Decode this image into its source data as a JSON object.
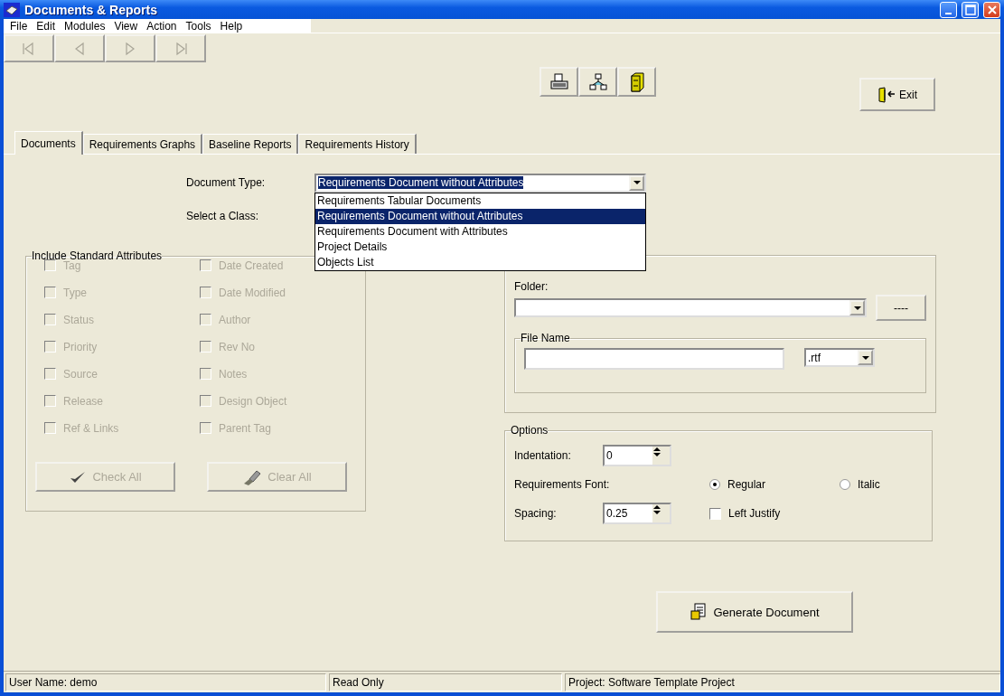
{
  "window": {
    "title": "Documents & Reports"
  },
  "menu": [
    "File",
    "Edit",
    "Modules",
    "View",
    "Action",
    "Tools",
    "Help"
  ],
  "nav_buttons": [
    {
      "kind": "first",
      "disabled": true
    },
    {
      "kind": "previous",
      "disabled": true
    },
    {
      "kind": "next",
      "disabled": true
    },
    {
      "kind": "last",
      "disabled": true
    }
  ],
  "tool_buttons": [
    {
      "kind": "print"
    },
    {
      "kind": "diagram"
    },
    {
      "kind": "cabinet"
    }
  ],
  "exit_button": {
    "label": "Exit"
  },
  "tabs": [
    {
      "label": "Documents",
      "selected": true
    },
    {
      "label": "Requirements Graphs",
      "selected": false
    },
    {
      "label": "Baseline Reports",
      "selected": false
    },
    {
      "label": "Requirements History",
      "selected": false
    }
  ],
  "document_type": {
    "label": "Document Type:",
    "value": "Requirements Document without Attributes",
    "expanded": true,
    "options": [
      {
        "label": "Requirements Tabular Documents",
        "selected": false
      },
      {
        "label": "Requirements Document without Attributes",
        "selected": true
      },
      {
        "label": "Requirements Document with Attributes",
        "selected": false
      },
      {
        "label": "Project Details",
        "selected": false
      },
      {
        "label": "Objects List",
        "selected": false
      }
    ]
  },
  "class_label": "Select a Class:",
  "attributes": {
    "title": "Include Standard Attributes",
    "items": [
      {
        "label": "Tag",
        "checked": false,
        "disabled": true
      },
      {
        "label": "Date Created",
        "checked": false,
        "disabled": true
      },
      {
        "label": "Type",
        "checked": false,
        "disabled": true
      },
      {
        "label": "Date Modified",
        "checked": false,
        "disabled": true
      },
      {
        "label": "Status",
        "checked": false,
        "disabled": true
      },
      {
        "label": "Author",
        "checked": false,
        "disabled": true
      },
      {
        "label": "Priority",
        "checked": false,
        "disabled": true
      },
      {
        "label": "Rev No",
        "checked": false,
        "disabled": true
      },
      {
        "label": "Source",
        "checked": false,
        "disabled": true
      },
      {
        "label": "Notes",
        "checked": false,
        "disabled": true
      },
      {
        "label": "Release",
        "checked": false,
        "disabled": true
      },
      {
        "label": "Design Object",
        "checked": false,
        "disabled": true
      },
      {
        "label": "Ref & Links",
        "checked": false,
        "disabled": true
      },
      {
        "label": "Parent Tag",
        "checked": false,
        "disabled": true
      }
    ],
    "buttons": [
      {
        "kind": "check",
        "label": "Check All",
        "disabled": true
      },
      {
        "kind": "clear",
        "label": "Clear All",
        "disabled": true
      }
    ]
  },
  "output": {
    "folder_label": "Folder:",
    "browse_button": "----",
    "file_name_title": "File Name",
    "extension": ".rtf"
  },
  "options": {
    "title": "Options",
    "indentation_label": "Indentation:",
    "indentation": "0",
    "font_label": "Requirements Font:",
    "font_styles": [
      {
        "label": "Regular",
        "selected": true
      },
      {
        "label": "Italic",
        "selected": false
      }
    ],
    "spacing_label": "Spacing:",
    "spacing": "0.25",
    "left_justify": {
      "label": "Left Justify",
      "checked": false
    }
  },
  "generate_button": {
    "label": "Generate Document"
  },
  "status_bar": [
    "User Name: demo",
    "Read Only",
    "Project: Software Template Project"
  ]
}
